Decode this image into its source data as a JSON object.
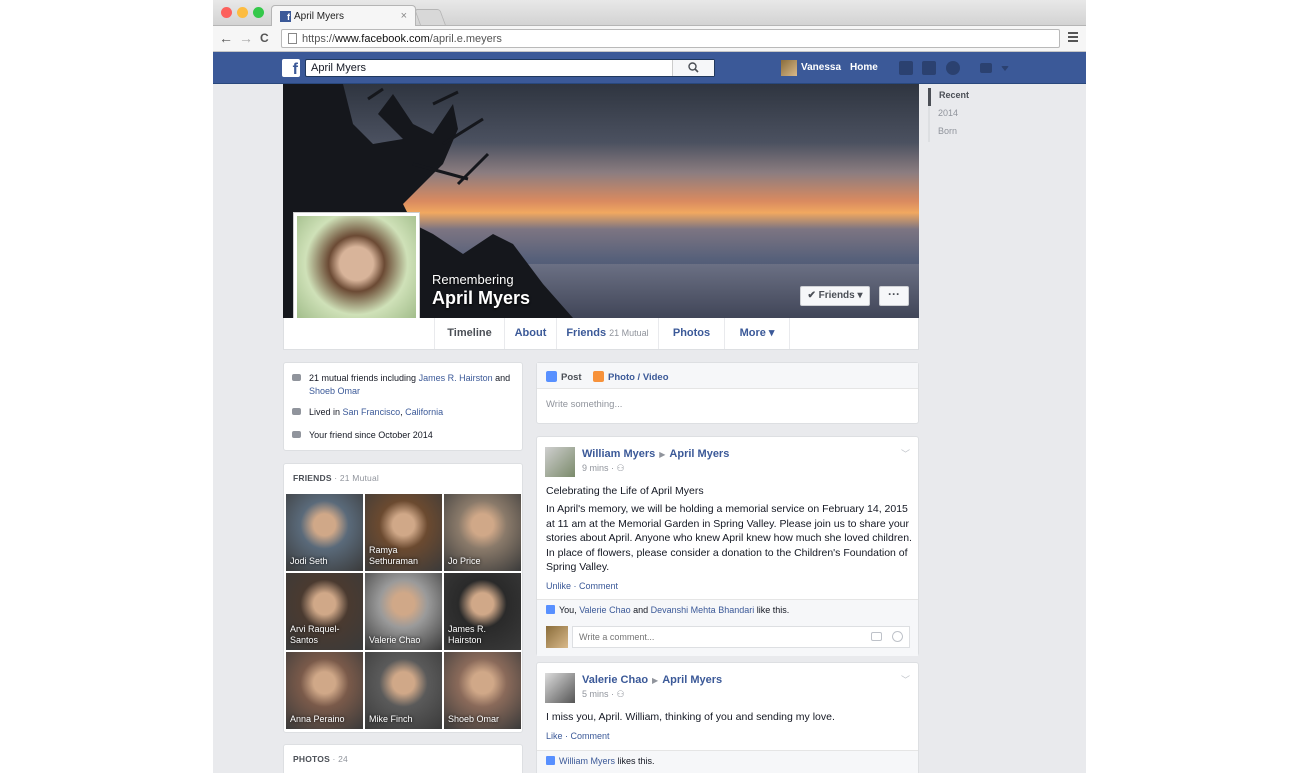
{
  "browser": {
    "tab_title": "April Myers",
    "tab_close": "×",
    "url_prefix": "https://",
    "url_host": "www.facebook.com",
    "url_path": "/april.e.meyers",
    "back": "←",
    "forward": "→",
    "reload": "C"
  },
  "fbbar": {
    "logo": "f",
    "search_value": "April Myers",
    "search_icon": "search-icon",
    "user_name": "Vanessa",
    "home_label": "Home"
  },
  "cover": {
    "remembering": "Remembering",
    "name": "April Myers",
    "friends_button": "✔ Friends ▾",
    "more_button": "···"
  },
  "tabs": [
    {
      "label": "Timeline"
    },
    {
      "label": "About"
    },
    {
      "label": "Friends",
      "sub": "21 Mutual"
    },
    {
      "label": "Photos"
    },
    {
      "label": "More ▾"
    }
  ],
  "timeline_nav": [
    "Recent",
    "2014",
    "Born"
  ],
  "intro": {
    "mutual_prefix": "21 mutual friends including",
    "mutual_friend_1": "James R. Hairston",
    "and": "and",
    "mutual_friend_2": "Shoeb Omar",
    "lived_prefix": "Lived in",
    "city": "San Francisco",
    "comma": ",",
    "state": "California",
    "friend_since": "Your friend since October 2014"
  },
  "friends_card": {
    "header": "FRIENDS",
    "sub": "· 21 Mutual",
    "friends": [
      {
        "name": "Jodi Seth",
        "color": "#5a6a7a"
      },
      {
        "name": "Ramya Sethuraman",
        "color": "#6b4a30"
      },
      {
        "name": "Jo Price",
        "color": "#8a7a6a"
      },
      {
        "name": "Arvi Raquel-Santos",
        "color": "#4a3a30"
      },
      {
        "name": "Valerie Chao",
        "color": "#9a9a9a"
      },
      {
        "name": "James R. Hairston",
        "color": "#2a2a2a"
      },
      {
        "name": "Anna Peraino",
        "color": "#7a5a4a"
      },
      {
        "name": "Mike Finch",
        "color": "#5a5a5a"
      },
      {
        "name": "Shoeb Omar",
        "color": "#8a6a5a"
      }
    ]
  },
  "photos_card": {
    "header": "PHOTOS",
    "sub": "· 24"
  },
  "composer": {
    "post_tab": "Post",
    "photo_tab": "Photo / Video",
    "placeholder": "Write something..."
  },
  "posts": [
    {
      "author": "William Myers",
      "target": "April Myers",
      "time": "9 mins · ⚇",
      "title": "Celebrating the Life of April Myers",
      "body": "In April's memory, we will be holding a memorial service on February 14, 2015 at 11 am at the Memorial Garden in Spring Valley. Please join us to share your stories about April. Anyone who knew April knew how much she loved children. In place of flowers, please consider a donation to the Children's Foundation of Spring Valley.",
      "action_1": "Unlike",
      "action_2": "Comment",
      "likes_prefix": "You,",
      "liker_1": "Valerie Chao",
      "likes_and": "and",
      "liker_2": "Devanshi Mehta Bhandari",
      "likes_suffix": "like this.",
      "comment_placeholder": "Write a comment..."
    },
    {
      "author": "Valerie Chao",
      "target": "April Myers",
      "time": "5 mins · ⚇",
      "body": "I miss you, April. William, thinking of you and sending my love.",
      "action_1": "Like",
      "action_2": "Comment",
      "liker_1": "William Myers",
      "likes_suffix": "likes this."
    }
  ]
}
